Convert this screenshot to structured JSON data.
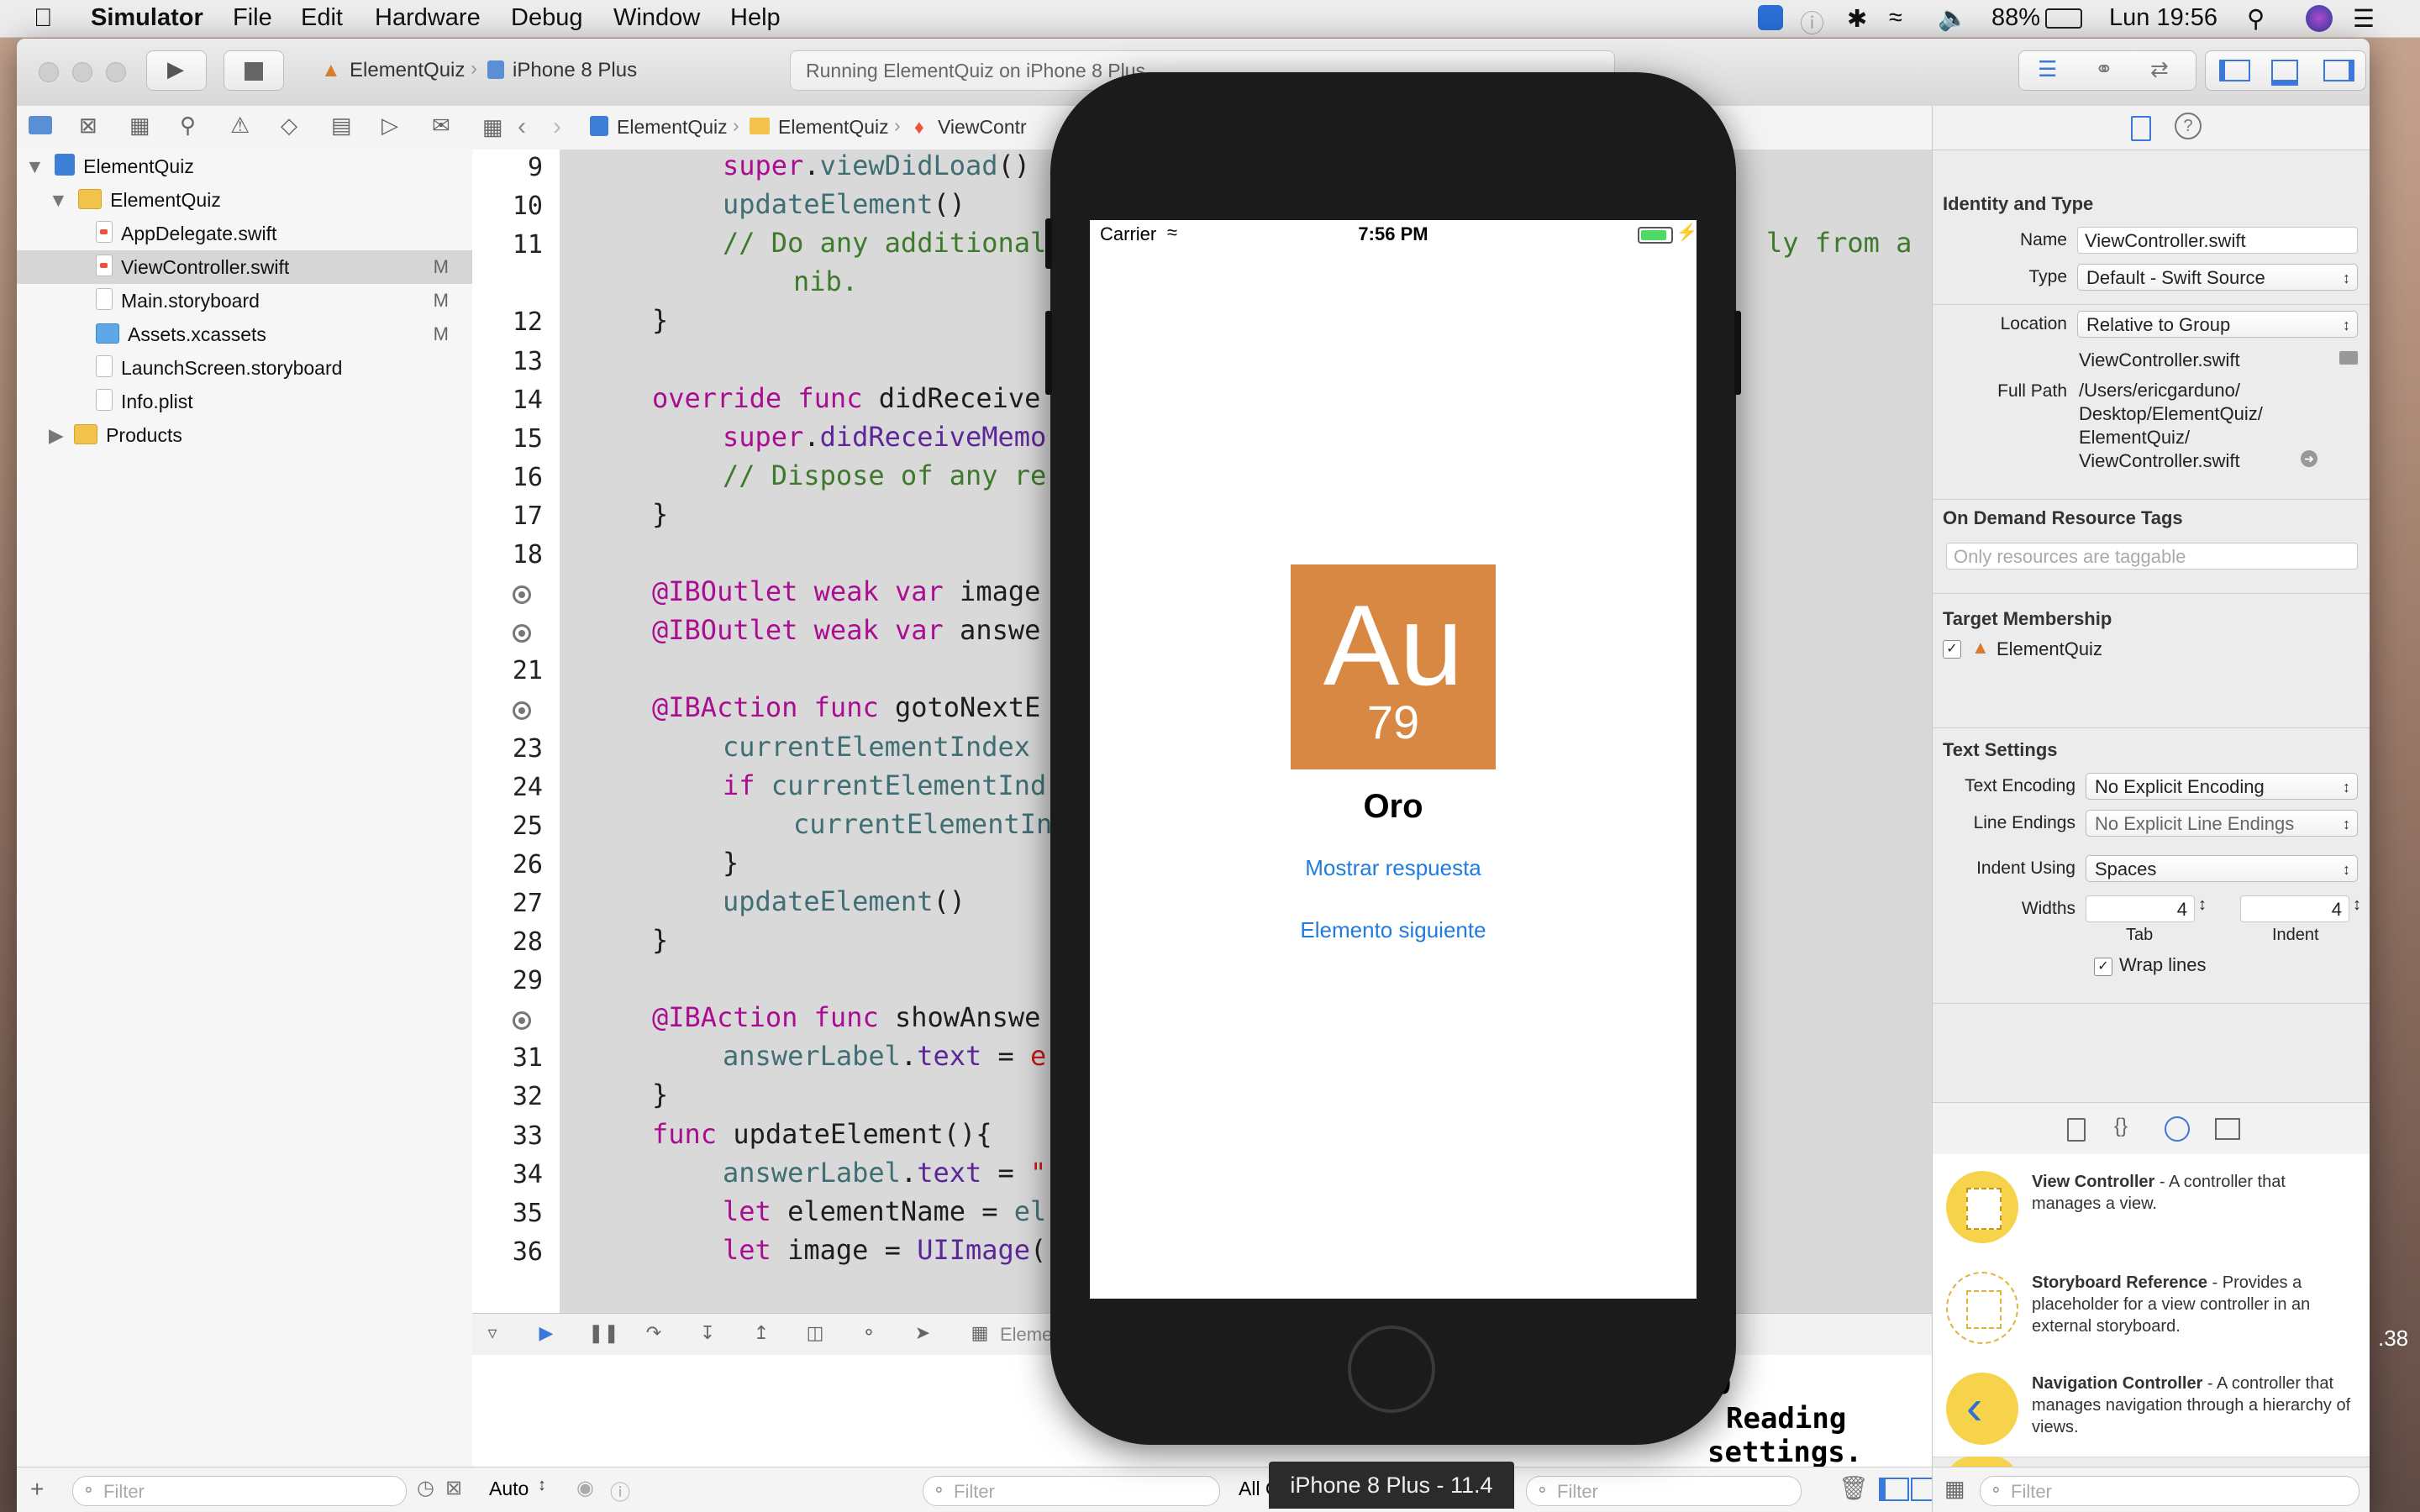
{
  "menubar": {
    "app": "Simulator",
    "items": [
      "File",
      "Edit",
      "Hardware",
      "Debug",
      "Window",
      "Help"
    ],
    "battery": "88%",
    "clock": "Lun 19:56"
  },
  "toolbar": {
    "scheme_app": "ElementQuiz",
    "scheme_device": "iPhone 8 Plus",
    "status": "Running ElementQuiz on iPhone 8 Plus"
  },
  "navigator": {
    "items": [
      {
        "label": "ElementQuiz",
        "badge": ""
      },
      {
        "label": "ElementQuiz",
        "badge": ""
      },
      {
        "label": "AppDelegate.swift",
        "badge": ""
      },
      {
        "label": "ViewController.swift",
        "badge": "M"
      },
      {
        "label": "Main.storyboard",
        "badge": "M"
      },
      {
        "label": "Assets.xcassets",
        "badge": "M"
      },
      {
        "label": "LaunchScreen.storyboard",
        "badge": ""
      },
      {
        "label": "Info.plist",
        "badge": ""
      },
      {
        "label": "Products",
        "badge": ""
      }
    ],
    "filter_placeholder": "Filter"
  },
  "jumpbar": {
    "crumb1": "ElementQuiz",
    "crumb2": "ElementQuiz",
    "crumb3": "ViewContr"
  },
  "editor": {
    "line_numbers": [
      "9",
      "10",
      "11",
      "",
      "12",
      "13",
      "14",
      "15",
      "16",
      "17",
      "18",
      "",
      "",
      "21",
      "",
      "23",
      "24",
      "25",
      "26",
      "27",
      "28",
      "29",
      "",
      "31",
      "32",
      "33",
      "34",
      "35",
      "36"
    ]
  },
  "debug": {
    "target": "Eleme",
    "auto_label": "Auto",
    "filter_placeholder": "Filter",
    "all_output": "All Ou",
    "console_text_1": "00",
    "console_text_2": "Reading",
    "console_text_3": "settings.",
    "side_number": ".38"
  },
  "inspector": {
    "identity_title": "Identity and Type",
    "name_label": "Name",
    "name_value": "ViewController.swift",
    "type_label": "Type",
    "type_value": "Default - Swift Source",
    "location_label": "Location",
    "location_value": "Relative to Group",
    "location_file": "ViewController.swift",
    "fullpath_label": "Full Path",
    "fullpath_lines": [
      "/Users/ericgarduno/",
      "Desktop/ElementQuiz/",
      "ElementQuiz/",
      "ViewController.swift"
    ],
    "ondemand_title": "On Demand Resource Tags",
    "ondemand_placeholder": "Only resources are taggable",
    "target_title": "Target Membership",
    "target_name": "ElementQuiz",
    "text_title": "Text Settings",
    "encoding_label": "Text Encoding",
    "encoding_value": "No Explicit Encoding",
    "endings_label": "Line Endings",
    "endings_value": "No Explicit Line Endings",
    "indent_label": "Indent Using",
    "indent_value": "Spaces",
    "widths_label": "Widths",
    "tab_value": "4",
    "indent_width_value": "4",
    "tab_caption": "Tab",
    "indent_caption": "Indent",
    "wrap_label": "Wrap lines",
    "library": [
      {
        "title": "View Controller",
        "desc": " - A controller that manages a view."
      },
      {
        "title": "Storyboard Reference",
        "desc": " - Provides a placeholder for a view controller in an external storyboard."
      },
      {
        "title": "Navigation Controller",
        "desc": " - A controller that manages navigation through a hierarchy of views."
      }
    ],
    "filter_placeholder": "Filter"
  },
  "simulator": {
    "carrier": "Carrier",
    "time": "7:56 PM",
    "symbol": "Au",
    "number": "79",
    "answer": "Oro",
    "show_answer": "Mostrar respuesta",
    "next_element": "Elemento siguiente",
    "device_label": "iPhone 8 Plus - 11.4",
    "tile_color": "#d98844",
    "link_color": "#1f7bdc"
  }
}
